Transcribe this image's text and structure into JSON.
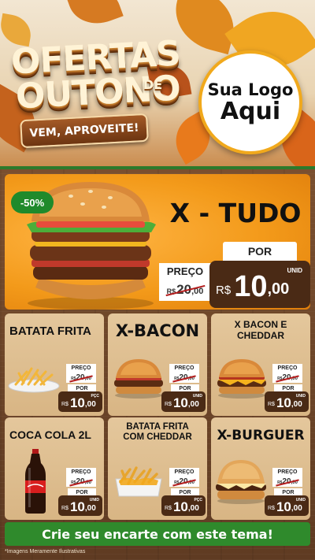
{
  "header": {
    "title_line1": "OFERTAS",
    "title_line2": "OUTONO",
    "title_de": "DE",
    "tagline": "VEM, APROVEITE!",
    "logo_line1": "Sua Logo",
    "logo_line2": "Aqui"
  },
  "hero": {
    "name": "X - TUDO",
    "discount": "-50%",
    "preco_label": "PREÇO",
    "old_int": "20",
    "old_dec": ",00",
    "old_cur": "R$",
    "por_label": "POR",
    "currency": "R$",
    "new_int": "10",
    "new_dec": ",00",
    "unit": "UNID"
  },
  "products": [
    {
      "name": "BATATA FRITA",
      "preco_label": "PREÇO",
      "old_cur": "R$",
      "old_int": "20",
      "old_dec": ",00",
      "por_label": "POR",
      "currency": "R$",
      "new_int": "10",
      "new_dec": ",00",
      "unit": "PÇC"
    },
    {
      "name": "X-BACON",
      "preco_label": "PREÇO",
      "old_cur": "R$",
      "old_int": "20",
      "old_dec": ",00",
      "por_label": "POR",
      "currency": "R$",
      "new_int": "10",
      "new_dec": ",00",
      "unit": "UNID"
    },
    {
      "name": "X BACON E CHEDDAR",
      "preco_label": "PREÇO",
      "old_cur": "R$",
      "old_int": "20",
      "old_dec": ",00",
      "por_label": "POR",
      "currency": "R$",
      "new_int": "10",
      "new_dec": ",00",
      "unit": "UNID"
    },
    {
      "name": "COCA COLA 2L",
      "preco_label": "PREÇO",
      "old_cur": "R$",
      "old_int": "20",
      "old_dec": ",00",
      "por_label": "POR",
      "currency": "R$",
      "new_int": "10",
      "new_dec": ",00",
      "unit": "UNID"
    },
    {
      "name": "BATATA FRITA COM CHEDDAR",
      "preco_label": "PREÇO",
      "old_cur": "R$",
      "old_int": "20",
      "old_dec": ",00",
      "por_label": "POR",
      "currency": "R$",
      "new_int": "10",
      "new_dec": ",00",
      "unit": "PÇC"
    },
    {
      "name": "X-BURGUER",
      "preco_label": "PREÇO",
      "old_cur": "R$",
      "old_int": "20",
      "old_dec": ",00",
      "por_label": "POR",
      "currency": "R$",
      "new_int": "10",
      "new_dec": ",00",
      "unit": "UNID"
    }
  ],
  "footer": {
    "cta": "Crie seu encarte com este tema!",
    "disclaimer": "*Imagens Meramente Ilustrativas"
  },
  "colors": {
    "hero_orange": "#f39a1a",
    "price_brown": "#4a2a15",
    "accent_green": "#2f8a2c",
    "card_beige": "#e4c79c"
  }
}
